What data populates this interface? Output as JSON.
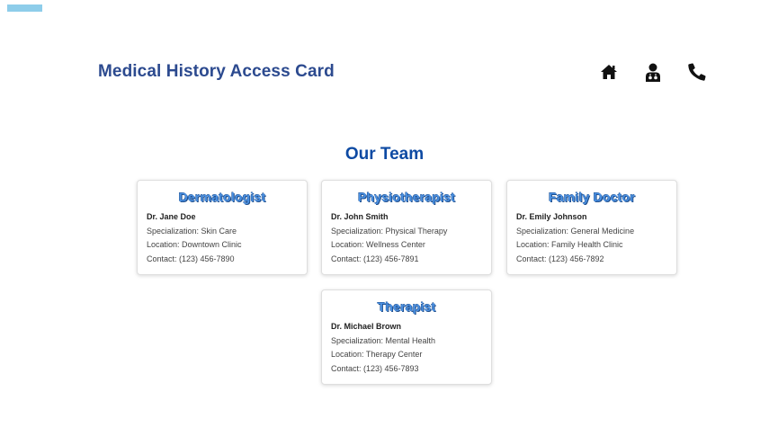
{
  "header": {
    "title": "Medical History Access Card",
    "nav_icons": [
      "home-icon",
      "doctor-icon",
      "phone-icon"
    ]
  },
  "team": {
    "title": "Our Team",
    "cards": [
      {
        "role": "Dermatologist",
        "name": "Dr. Jane Doe",
        "specialization": "Specialization: Skin Care",
        "location": "Location: Downtown Clinic",
        "contact": "Contact: (123) 456-7890"
      },
      {
        "role": "Physiotherapist",
        "name": "Dr. John Smith",
        "specialization": "Specialization: Physical Therapy",
        "location": "Location: Wellness Center",
        "contact": "Contact: (123) 456-7891"
      },
      {
        "role": "Family Doctor",
        "name": "Dr. Emily Johnson",
        "specialization": "Specialization: General Medicine",
        "location": "Location: Family Health Clinic",
        "contact": "Contact: (123) 456-7892"
      },
      {
        "role": "Therapist",
        "name": "Dr. Michael Brown",
        "specialization": "Specialization: Mental Health",
        "location": "Location: Therapy Center",
        "contact": "Contact: (123) 456-7893"
      }
    ]
  },
  "colors": {
    "accent_bar": "#8ecdea",
    "header_title": "#2c4a8f",
    "section_title": "#0d4aa3",
    "card_title": "#4a90e2"
  }
}
